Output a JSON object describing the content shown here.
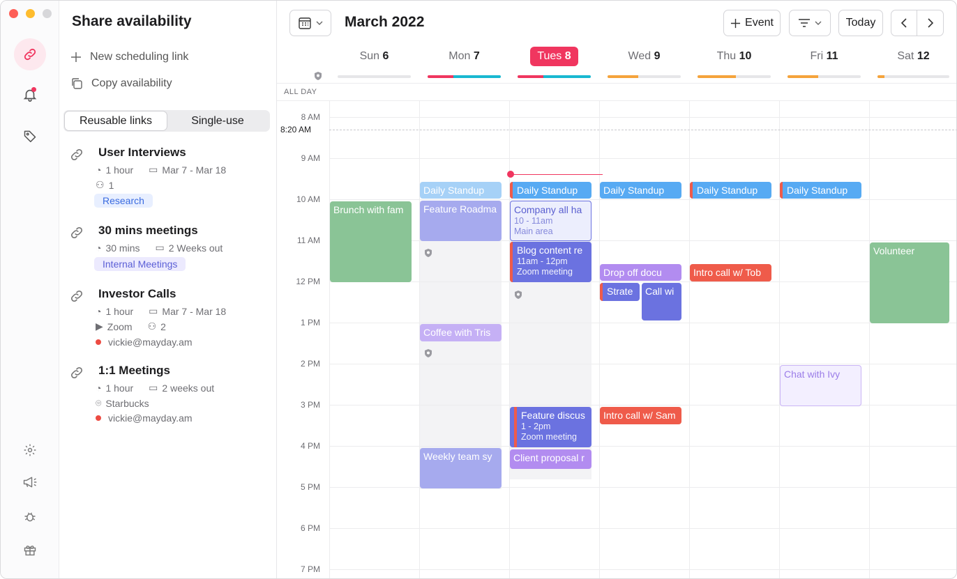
{
  "share": {
    "title": "Share availability",
    "new_link": "New scheduling link",
    "copy": "Copy availability",
    "tabs": [
      "Reusable links",
      "Single-use"
    ],
    "links": [
      {
        "title": "User Interviews",
        "duration": "1 hour",
        "range": "Mar 7 - Mar 18",
        "people": "1",
        "tag": "Research"
      },
      {
        "title": "30 mins meetings",
        "duration": "30 mins",
        "range": "2 Weeks out",
        "tag": "Internal Meetings"
      },
      {
        "title": "Investor Calls",
        "duration": "1 hour",
        "range": "Mar 7 - Mar 18",
        "location": "Zoom",
        "people": "2",
        "email": "vickie@mayday.am"
      },
      {
        "title": "1:1 Meetings",
        "duration": "1 hour",
        "range": "2 weeks out",
        "location": "Starbucks",
        "email": "vickie@mayday.am"
      }
    ]
  },
  "toolbar": {
    "month": "March 2022",
    "event_btn": "Event",
    "today_btn": "Today"
  },
  "days": [
    {
      "name": "Sun",
      "num": "6"
    },
    {
      "name": "Mon",
      "num": "7"
    },
    {
      "name": "Tues",
      "num": "8"
    },
    {
      "name": "Wed",
      "num": "9"
    },
    {
      "name": "Thu",
      "num": "10"
    },
    {
      "name": "Fri",
      "num": "11"
    },
    {
      "name": "Sat",
      "num": "12"
    }
  ],
  "day_load_colors": {
    "pink": "#f0365f",
    "teal": "#19b8d1",
    "orange": "#f5a33b"
  },
  "calendar": {
    "all_day": "ALL DAY",
    "now": "8:20 AM",
    "hours": [
      "8 AM",
      "9 AM",
      "10 AM",
      "11 AM",
      "12 PM",
      "1 PM",
      "2 PM",
      "3 PM",
      "4 PM",
      "5 PM",
      "6 PM",
      "7 PM"
    ]
  },
  "events": {
    "standup": "Daily Standup",
    "brunch": "Brunch with fam",
    "roadmap": "Feature Roadma",
    "company": "Company all ha",
    "company_time": "10 - 11am",
    "company_loc": "Main area",
    "blog": "Blog content re",
    "blog_time": "11am - 12pm",
    "blog_loc": "Zoom meeting",
    "dropoff": "Drop off docu",
    "strategy": "Strate",
    "call": "Call wi",
    "intro_tob": "Intro call w/ Tob",
    "volunteer": "Volunteer",
    "coffee": "Coffee with Tris",
    "chat_ivy": "Chat with Ivy",
    "feature_disc": "Feature discus",
    "feature_time": "1 - 2pm",
    "feature_loc": "Zoom meeting",
    "intro_sam": "Intro call w/ Sam",
    "weekly": "Weekly team sy",
    "client": "Client proposal r"
  }
}
